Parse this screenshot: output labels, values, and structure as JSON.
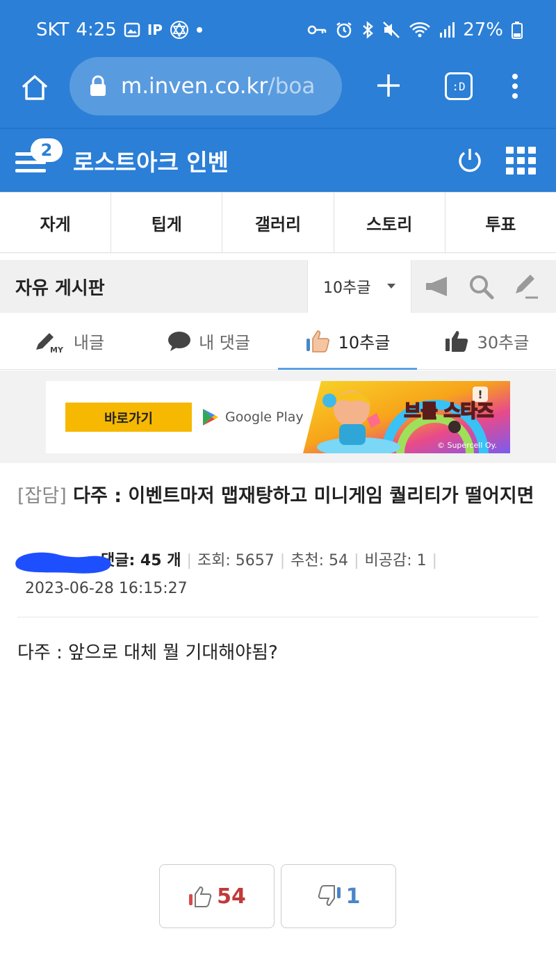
{
  "status": {
    "carrier": "SKT",
    "time": "4:25",
    "battery": "27%",
    "left_icons": [
      "image-icon",
      "ip-icon",
      "star-of-david-icon",
      "dot-icon"
    ],
    "right_icons": [
      "key-icon",
      "alarm-icon",
      "bluetooth-icon",
      "mute-icon",
      "wifi-icon",
      "signal-icon",
      "battery-icon"
    ]
  },
  "browser": {
    "url_host": "m.inven.co.kr",
    "url_path": "/boa",
    "tab_label": ":D"
  },
  "site": {
    "title": "로스트아크 인벤",
    "menu_badge": "2"
  },
  "categories": [
    "자게",
    "팁게",
    "갤러리",
    "스토리",
    "투표"
  ],
  "board": {
    "title": "자유 게시판",
    "filter": "10추글"
  },
  "subtabs": [
    {
      "label": "내글",
      "icon": "pencil-my-icon"
    },
    {
      "label": "내 댓글",
      "icon": "speech-bubble-icon"
    },
    {
      "label": "10추글",
      "icon": "thumbs-up-icon",
      "active": true
    },
    {
      "label": "30추글",
      "icon": "thumbs-up-icon"
    }
  ],
  "ad": {
    "button": "바로가기",
    "store": "Google Play",
    "game_title": "브롤 스타즈",
    "copyright": "© Supercell Oy."
  },
  "post": {
    "category": "[잡담]",
    "title": "다주 : 이벤트마저 맵재탕하고 미니게임 퀄리티가 떨어지면",
    "comments_label": "댓글: 45 개",
    "views": "조회: 5657",
    "recommends": "추천: 54",
    "dislikes": "비공감: 1",
    "date": "2023-06-28 16:15:27",
    "body": "다주 : 앞으로 대체 뭘 기대해야됨?"
  },
  "votes": {
    "up": "54",
    "down": "1"
  },
  "colors": {
    "brand_blue": "#2b7fd6",
    "vote_red": "#c03a3a",
    "vote_blue": "#4a86c8",
    "ad_button": "#f6b800"
  }
}
